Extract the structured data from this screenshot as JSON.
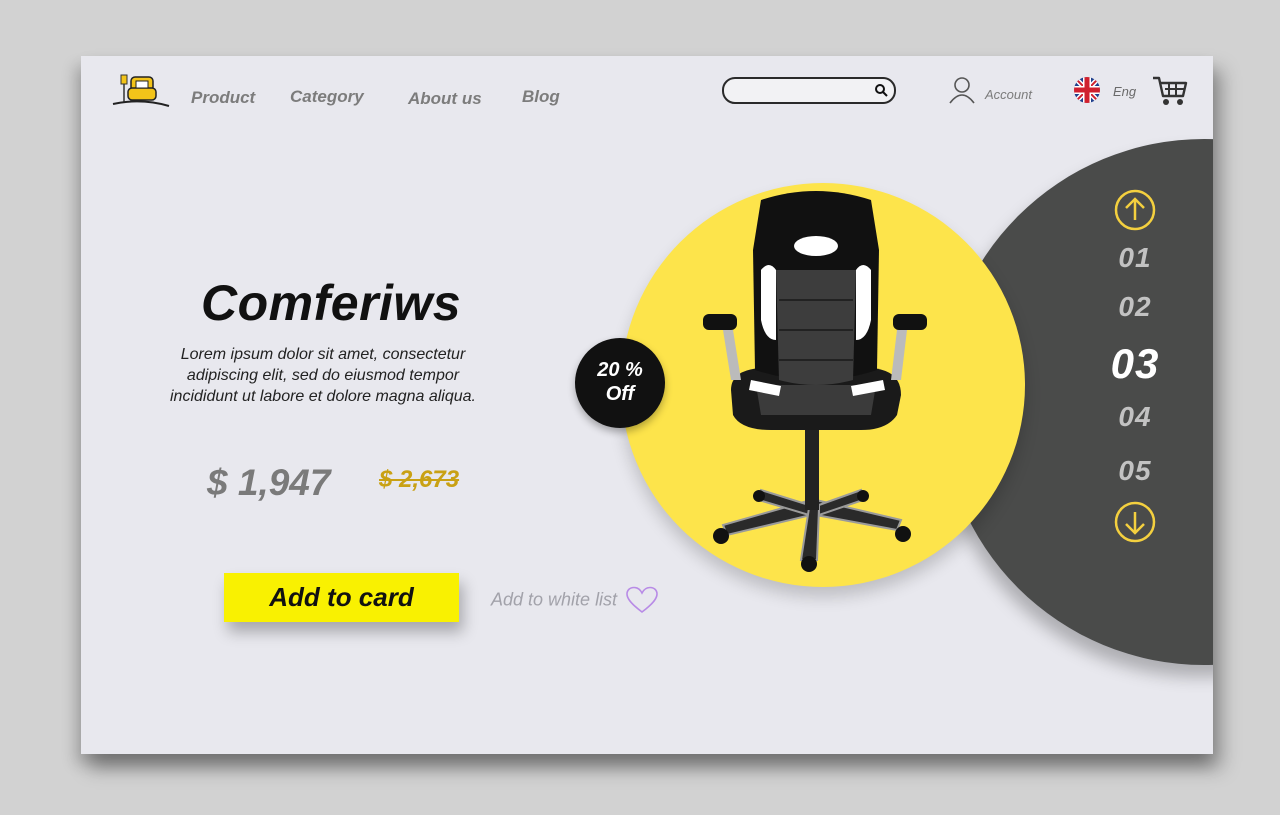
{
  "brand": {
    "accent": "#f9f101",
    "yellow_circle": "#fde44b",
    "dark": "#4a4b4a",
    "old_price_color": "#c9a114"
  },
  "nav": {
    "items": [
      {
        "label": "Product"
      },
      {
        "label": "Category"
      },
      {
        "label": "About us"
      },
      {
        "label": "Blog"
      }
    ]
  },
  "search": {
    "value": "",
    "placeholder": "",
    "icon": "search-icon"
  },
  "account": {
    "label": "Account",
    "icon": "user-icon"
  },
  "language": {
    "label": "Eng",
    "icon": "uk-flag-icon"
  },
  "cart": {
    "icon": "shopping-cart-icon"
  },
  "hero": {
    "title": "Comferiws",
    "description": "Lorem ipsum dolor sit amet, consectetur adipiscing elit, sed do eiusmod tempor incididunt ut labore et dolore magna aliqua.",
    "price": "$ 1,947",
    "old_price": "$ 2,673",
    "discount_line1": "20 %",
    "discount_line2": "Off",
    "add_button": "Add to card",
    "wishlist_label": "Add to white list"
  },
  "slider": {
    "numbers": [
      "01",
      "02",
      "03",
      "04",
      "05"
    ],
    "active": "03",
    "up_icon": "arrow-up-circle-icon",
    "down_icon": "arrow-down-circle-icon"
  }
}
